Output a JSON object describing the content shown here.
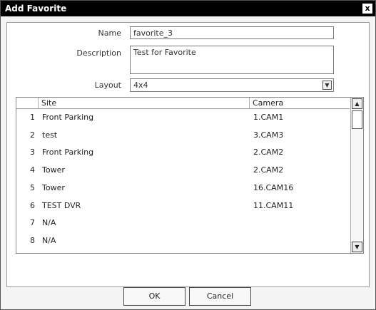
{
  "window": {
    "title": "Add Favorite",
    "close_label": "x"
  },
  "form": {
    "name_label": "Name",
    "name_value": "favorite_3",
    "description_label": "Description",
    "description_value": "Test for Favorite",
    "layout_label": "Layout",
    "layout_value": "4x4"
  },
  "table": {
    "columns": [
      "Site",
      "Camera"
    ],
    "rows": [
      {
        "num": "1",
        "site": "Front Parking",
        "camera": "1.CAM1"
      },
      {
        "num": "2",
        "site": "test",
        "camera": "3.CAM3"
      },
      {
        "num": "3",
        "site": "Front Parking",
        "camera": "2.CAM2"
      },
      {
        "num": "4",
        "site": "Tower",
        "camera": "2.CAM2"
      },
      {
        "num": "5",
        "site": "Tower",
        "camera": "16.CAM16"
      },
      {
        "num": "6",
        "site": "TEST DVR",
        "camera": "11.CAM11"
      },
      {
        "num": "7",
        "site": "N/A",
        "camera": ""
      },
      {
        "num": "8",
        "site": "N/A",
        "camera": ""
      }
    ]
  },
  "buttons": {
    "ok": "OK",
    "cancel": "Cancel"
  }
}
